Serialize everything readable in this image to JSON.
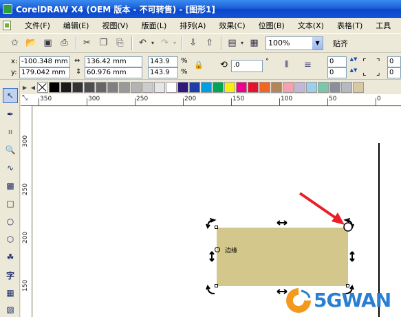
{
  "window": {
    "title": "CorelDRAW X4 (OEM 版本 - 不可转售) - [图形1]"
  },
  "menu": [
    "文件(F)",
    "编辑(E)",
    "视图(V)",
    "版面(L)",
    "排列(A)",
    "效果(C)",
    "位图(B)",
    "文本(X)",
    "表格(T)",
    "工具"
  ],
  "toolbar": {
    "zoom": "100%",
    "align_label": "贴齐"
  },
  "property_bar": {
    "x_label": "x:",
    "x_value": "-100.348 mm",
    "y_label": "y:",
    "y_value": "179.042 mm",
    "width_value": "136.42 mm",
    "height_value": "60.976 mm",
    "scale_w": "143.9",
    "scale_h": "143.9",
    "percent": "%",
    "rotation": ".0",
    "degree": "°",
    "corner_1": "0",
    "corner_2": "0",
    "corner_3": "0",
    "corner_4": "0"
  },
  "palette": {
    "colors": [
      "#000000",
      "#1a1a1a",
      "#333333",
      "#4d4d4d",
      "#666666",
      "#808080",
      "#999999",
      "#b3b3b3",
      "#cccccc",
      "#e6e6e6",
      "#ffffff",
      "#2e1a7a",
      "#1f3fa8",
      "#00a0e0",
      "#00a651",
      "#f7ec13",
      "#ec008c",
      "#e8112d",
      "#f26522",
      "#b5855a",
      "#f5a1b0",
      "#c4b7d6",
      "#9ad0ea",
      "#7ac8a8",
      "#8a8f9a",
      "#b6b9c0",
      "#d8c9a3"
    ]
  },
  "ruler": {
    "h_labels": [
      "350",
      "300",
      "250",
      "200",
      "150",
      "100",
      "50",
      "0"
    ],
    "v_labels": [
      "300",
      "250",
      "200",
      "150"
    ]
  },
  "canvas": {
    "rect_fill": "#d4c78c",
    "rect_label": "边缘"
  },
  "watermark": {
    "text": "5GWAN"
  }
}
